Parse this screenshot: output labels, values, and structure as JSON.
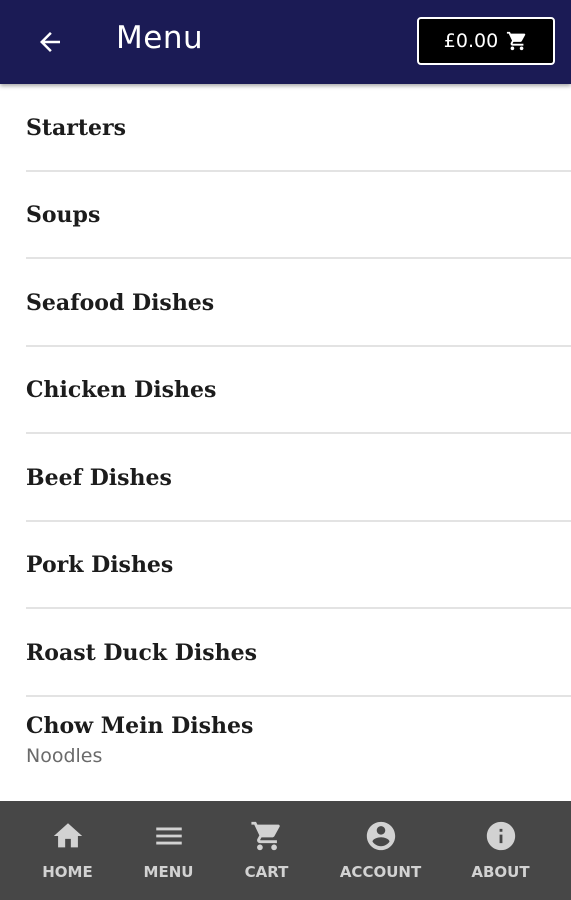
{
  "header": {
    "title": "Menu",
    "back_icon": "arrow-left-icon",
    "cart_total": "£0.00",
    "cart_icon": "shopping-cart-icon",
    "background": "#1b1b55"
  },
  "categories": [
    {
      "title": "Starters",
      "subtitle": ""
    },
    {
      "title": "Soups",
      "subtitle": ""
    },
    {
      "title": "Seafood Dishes",
      "subtitle": ""
    },
    {
      "title": "Chicken Dishes",
      "subtitle": ""
    },
    {
      "title": "Beef Dishes",
      "subtitle": ""
    },
    {
      "title": "Pork Dishes",
      "subtitle": ""
    },
    {
      "title": "Roast Duck Dishes",
      "subtitle": ""
    },
    {
      "title": "Chow Mein Dishes",
      "subtitle": "Noodles"
    }
  ],
  "bottom_nav": [
    {
      "label": "HOME",
      "icon": "home-icon"
    },
    {
      "label": "MENU",
      "icon": "menu-icon"
    },
    {
      "label": "CART",
      "icon": "cart-icon"
    },
    {
      "label": "ACCOUNT",
      "icon": "account-icon"
    },
    {
      "label": "ABOUT",
      "icon": "info-icon"
    }
  ]
}
